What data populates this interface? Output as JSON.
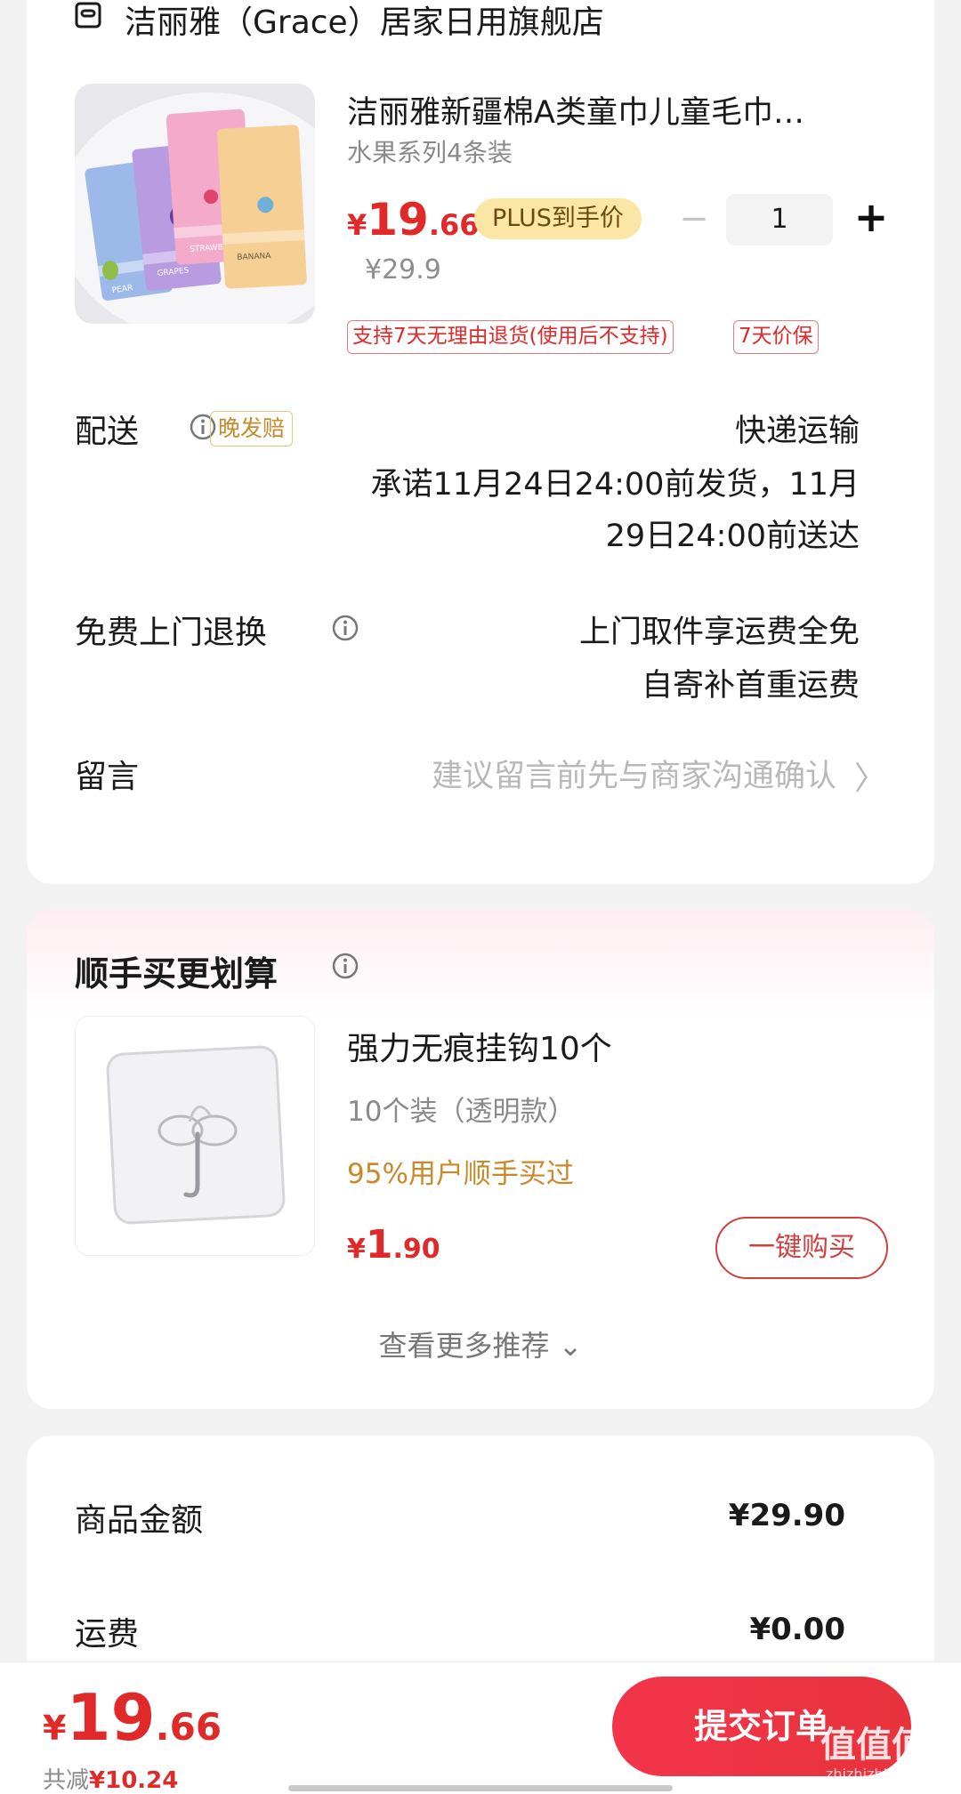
{
  "store": {
    "name": "洁丽雅（Grace）居家日用旗舰店",
    "icon": "store-icon"
  },
  "product": {
    "title": "洁丽雅新疆棉A类童巾儿童毛巾…",
    "variant": "水果系列4条装",
    "price_symbol": "¥",
    "price_int": "19",
    "price_dec": ".66",
    "plus_badge": "PLUS到手价",
    "original_price": "¥29.9",
    "quantity": "1",
    "minus_symbol": "−",
    "plus_symbol": "+",
    "tags": [
      "支持7天无理由退货(使用后不支持)",
      "7天价保"
    ],
    "towel_labels": [
      "PEAR",
      "GRAPES",
      "STRAWB",
      "BANANA"
    ]
  },
  "delivery": {
    "label": "配送",
    "badge": "晚发赔",
    "method": "快递运输",
    "promise_line1": "承诺11月24日24:00前发货，11月",
    "promise_line2": "29日24:00前送达"
  },
  "returns": {
    "label": "免费上门退换",
    "line1": "上门取件享运费全免",
    "line2": "自寄补首重运费"
  },
  "message": {
    "label": "留言",
    "placeholder": "建议留言前先与商家沟通确认",
    "chevron": "〉"
  },
  "addon": {
    "title": "顺手买更划算",
    "name": "强力无痕挂钩10个",
    "variant": "10个装（透明款）",
    "social": "95%用户顺手买过",
    "price_symbol": "¥",
    "price_int": "1",
    "price_dec": ".90",
    "buy_label": "一键购买",
    "more_label": "查看更多推荐 ⌄"
  },
  "summary": {
    "rows": [
      {
        "label": "商品金额",
        "value": "¥29.90"
      },
      {
        "label": "运费",
        "value": "¥0.00"
      }
    ]
  },
  "bottom": {
    "price_symbol": "¥",
    "price_int": "19",
    "price_dec": ".66",
    "discount_prefix": "共减",
    "discount_amount": "¥10.24",
    "submit_label": "提交订单"
  },
  "watermark": {
    "text": "值值值",
    "sub": "zhizhizhi.com"
  },
  "colors": {
    "accent": "#e02a2a",
    "plus_badge_bg": "#fbe6a6",
    "social_orange": "#c9892a"
  }
}
